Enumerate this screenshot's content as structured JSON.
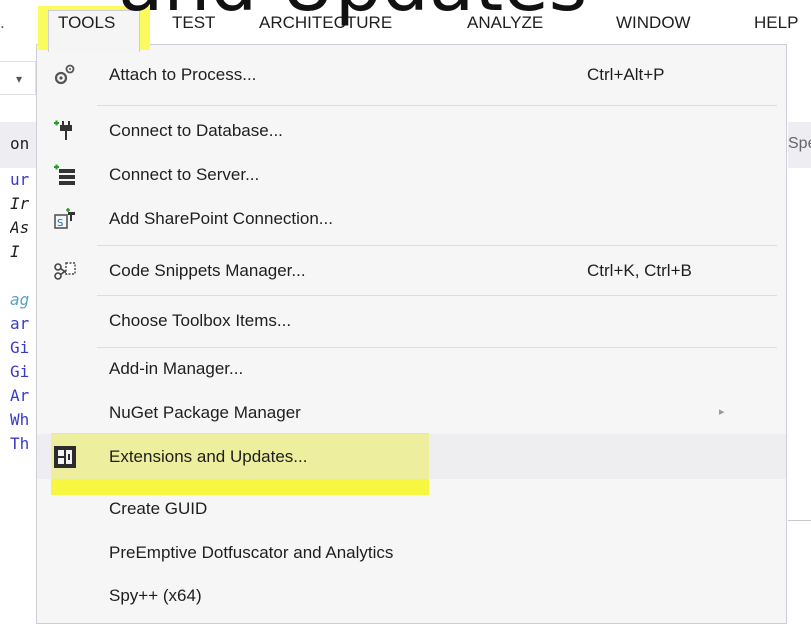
{
  "overlay_caption": "and Updates",
  "menubar": {
    "items": [
      {
        "label": "TOOLS",
        "active": true
      },
      {
        "label": "TEST"
      },
      {
        "label": "ARCHITECTURE"
      },
      {
        "label": "ANALYZE"
      },
      {
        "label": "WINDOW"
      },
      {
        "label": "HELP"
      }
    ]
  },
  "editor": {
    "code_lines": [
      {
        "text": "on",
        "color": "#1e1e1e"
      },
      {
        "text": "ur",
        "color": "#3a3ac8"
      },
      {
        "text": "Ir",
        "color": "#1e1e1e"
      },
      {
        "text": "As",
        "color": "#1e1e1e"
      },
      {
        "text": "I",
        "color": "#1e1e1e"
      },
      {
        "text": "ag",
        "color": "#5aa0c8"
      },
      {
        "text": "ar",
        "color": "#3a3ac8"
      },
      {
        "text": "Gi",
        "color": "#3a3ac8"
      },
      {
        "text": "Gi",
        "color": "#3a3ac8"
      },
      {
        "text": "Ar",
        "color": "#3a3ac8"
      },
      {
        "text": "Wh",
        "color": "#3a3ac8"
      },
      {
        "text": "Th",
        "color": "#3a3ac8"
      }
    ],
    "right_fragment": "Spe"
  },
  "tools_menu": {
    "items": [
      {
        "label": "Attach to Process...",
        "shortcut": "Ctrl+Alt+P",
        "icon": "attach-process-icon"
      },
      {
        "label": "Connect to Database...",
        "shortcut": "",
        "icon": "connect-database-icon"
      },
      {
        "label": "Connect to Server...",
        "shortcut": "",
        "icon": "connect-server-icon"
      },
      {
        "label": "Add SharePoint Connection...",
        "shortcut": "",
        "icon": "sharepoint-icon"
      },
      {
        "label": "Code Snippets Manager...",
        "shortcut": "Ctrl+K, Ctrl+B",
        "icon": "code-snippets-icon"
      },
      {
        "label": "Choose Toolbox Items...",
        "shortcut": "",
        "icon": ""
      },
      {
        "label": "Add-in Manager...",
        "shortcut": "",
        "icon": ""
      },
      {
        "label": "NuGet Package Manager",
        "shortcut": "",
        "icon": "",
        "submenu": true
      },
      {
        "label": "Extensions and Updates...",
        "shortcut": "",
        "icon": "extensions-icon",
        "hovered": true
      },
      {
        "label": "Create GUID",
        "shortcut": "",
        "icon": ""
      },
      {
        "label": "PreEmptive Dotfuscator and Analytics",
        "shortcut": "",
        "icon": ""
      },
      {
        "label": "Spy++ (x64)",
        "shortcut": "",
        "icon": ""
      }
    ],
    "submenu_arrow": "▸"
  },
  "colors": {
    "highlight": "#f7f742",
    "menu_bg": "#f6f6f6",
    "hover_bg": "#e8e8ec",
    "border": "#cccedb"
  }
}
